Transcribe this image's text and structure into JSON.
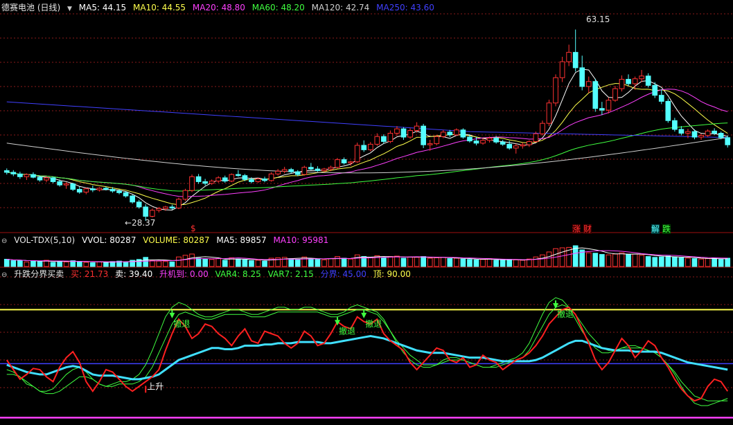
{
  "price_panel": {
    "title": "德赛电池 (日线)",
    "ma": [
      {
        "label": "MA5: 44.15",
        "color": "#ffffff"
      },
      {
        "label": "MA10: 44.55",
        "color": "#ffff4c"
      },
      {
        "label": "MA20: 48.80",
        "color": "#ff40ff"
      },
      {
        "label": "MA60: 48.20",
        "color": "#40ff40"
      },
      {
        "label": "MA120: 42.74",
        "color": "#d0d0d0"
      },
      {
        "label": "MA250: 43.60",
        "color": "#4040ff"
      }
    ],
    "high_label": "63.15",
    "low_label": "←28.37",
    "events": {
      "dollar": "$",
      "zhang": "涨",
      "cai": "财",
      "jie": "解",
      "die": "跌"
    }
  },
  "volume_panel": {
    "title": "VOL-TDX(5,10)",
    "items": [
      {
        "label": "VVOL: 80287",
        "color": "#ffffff"
      },
      {
        "label": "VOLUME: 80287",
        "color": "#ffff4c"
      },
      {
        "label": "MA5: 89857",
        "color": "#ffffff"
      },
      {
        "label": "MA10: 95981",
        "color": "#ff40ff"
      }
    ]
  },
  "indicator_panel": {
    "title": "升跌分界买卖",
    "items": [
      {
        "label": "买: 21.73",
        "color": "#ff3030"
      },
      {
        "label": "卖: 39.40",
        "color": "#ffffff"
      },
      {
        "label": "升机到: 0.00",
        "color": "#ff40ff"
      },
      {
        "label": "VAR4: 8.25",
        "color": "#40ff40"
      },
      {
        "label": "VAR7: 2.15",
        "color": "#40ff40"
      },
      {
        "label": "分界: 45.00",
        "color": "#4040ff"
      },
      {
        "label": "顶: 90.00",
        "color": "#ffff4c"
      }
    ],
    "signal_up": "上升",
    "signal_exit": "撤退"
  },
  "colors": {
    "up": "#ff3232",
    "down": "#54ffff",
    "grid": "#8b1a1a",
    "panel_sep": "#a01010"
  },
  "chart_data": {
    "type": "candlestick",
    "candles": [
      [
        37.5,
        37.9,
        36.8,
        37.2
      ],
      [
        37.2,
        37.6,
        36.5,
        36.9
      ],
      [
        36.9,
        37.3,
        36.0,
        36.4
      ],
      [
        36.4,
        37.0,
        35.8,
        36.8
      ],
      [
        36.8,
        37.2,
        36.1,
        36.3
      ],
      [
        36.3,
        36.6,
        35.5,
        35.8
      ],
      [
        35.8,
        36.5,
        35.4,
        36.2
      ],
      [
        36.2,
        36.4,
        35.2,
        35.5
      ],
      [
        35.5,
        35.9,
        34.6,
        34.9
      ],
      [
        34.9,
        35.4,
        34.2,
        35.1
      ],
      [
        35.1,
        35.3,
        33.8,
        34.1
      ],
      [
        34.1,
        34.6,
        33.3,
        33.6
      ],
      [
        33.6,
        34.4,
        33.2,
        34.2
      ],
      [
        34.2,
        34.8,
        33.6,
        34.0
      ],
      [
        34.0,
        34.5,
        33.7,
        34.3
      ],
      [
        34.3,
        34.6,
        33.9,
        34.1
      ],
      [
        34.1,
        34.5,
        33.5,
        33.8
      ],
      [
        33.8,
        34.1,
        33.2,
        33.5
      ],
      [
        33.5,
        33.8,
        32.6,
        32.9
      ],
      [
        32.9,
        33.1,
        31.5,
        31.8
      ],
      [
        31.8,
        32.2,
        30.6,
        30.9
      ],
      [
        30.9,
        31.4,
        28.37,
        29.2
      ],
      [
        29.2,
        30.6,
        29.0,
        30.3
      ],
      [
        30.3,
        30.9,
        29.9,
        30.6
      ],
      [
        30.6,
        31.1,
        30.2,
        30.9
      ],
      [
        30.9,
        31.3,
        30.4,
        30.7
      ],
      [
        30.7,
        32.6,
        30.5,
        32.3
      ],
      [
        32.3,
        34.2,
        32.0,
        33.9
      ],
      [
        33.9,
        36.8,
        33.6,
        36.4
      ],
      [
        36.4,
        36.9,
        35.1,
        35.5
      ],
      [
        35.5,
        36.0,
        34.8,
        35.2
      ],
      [
        35.2,
        35.9,
        34.9,
        35.6
      ],
      [
        35.6,
        36.5,
        35.3,
        36.2
      ],
      [
        36.2,
        36.6,
        35.3,
        35.6
      ],
      [
        35.6,
        37.0,
        35.4,
        36.8
      ],
      [
        36.8,
        37.6,
        36.4,
        36.6
      ],
      [
        36.6,
        36.9,
        35.6,
        35.9
      ],
      [
        35.9,
        36.3,
        35.2,
        35.5
      ],
      [
        35.5,
        36.2,
        35.3,
        36.0
      ],
      [
        36.0,
        36.4,
        35.4,
        35.7
      ],
      [
        35.7,
        37.2,
        35.5,
        36.9
      ],
      [
        36.9,
        37.8,
        36.6,
        37.4
      ],
      [
        37.4,
        38.2,
        37.0,
        37.7
      ],
      [
        37.7,
        38.0,
        37.0,
        37.3
      ],
      [
        37.3,
        37.6,
        36.5,
        36.8
      ],
      [
        36.8,
        38.4,
        36.6,
        38.1
      ],
      [
        38.1,
        38.9,
        37.6,
        37.8
      ],
      [
        37.8,
        38.3,
        37.3,
        37.5
      ],
      [
        37.5,
        38.0,
        37.2,
        37.8
      ],
      [
        37.8,
        38.4,
        37.4,
        38.1
      ],
      [
        38.1,
        39.8,
        37.9,
        39.5
      ],
      [
        39.5,
        39.9,
        38.6,
        38.9
      ],
      [
        38.9,
        39.3,
        38.4,
        39.1
      ],
      [
        39.1,
        42.6,
        38.9,
        42.1
      ],
      [
        42.1,
        43.0,
        40.9,
        41.3
      ],
      [
        41.3,
        42.7,
        41.0,
        42.3
      ],
      [
        42.3,
        44.3,
        42.0,
        43.7
      ],
      [
        43.7,
        44.1,
        42.4,
        42.8
      ],
      [
        42.8,
        44.8,
        42.5,
        44.3
      ],
      [
        44.3,
        45.6,
        43.8,
        45.1
      ],
      [
        45.1,
        45.4,
        43.1,
        43.6
      ],
      [
        43.6,
        45.2,
        43.3,
        44.8
      ],
      [
        44.8,
        46.3,
        44.4,
        45.6
      ],
      [
        45.6,
        46.0,
        41.6,
        42.2
      ],
      [
        42.2,
        43.1,
        41.1,
        42.4
      ],
      [
        42.4,
        44.0,
        42.1,
        43.7
      ],
      [
        43.7,
        44.9,
        43.4,
        44.5
      ],
      [
        44.5,
        44.9,
        43.6,
        44.0
      ],
      [
        44.0,
        45.2,
        43.8,
        44.9
      ],
      [
        44.9,
        45.2,
        43.3,
        43.6
      ],
      [
        43.6,
        44.1,
        42.6,
        42.9
      ],
      [
        42.9,
        43.6,
        42.1,
        42.5
      ],
      [
        42.5,
        43.3,
        42.2,
        43.0
      ],
      [
        43.0,
        43.7,
        42.6,
        43.4
      ],
      [
        43.4,
        43.8,
        42.4,
        42.7
      ],
      [
        42.7,
        43.1,
        42.0,
        42.3
      ],
      [
        42.3,
        42.9,
        41.3,
        41.6
      ],
      [
        41.6,
        42.4,
        40.6,
        42.0
      ],
      [
        42.0,
        42.6,
        41.5,
        42.2
      ],
      [
        42.2,
        43.0,
        41.8,
        42.8
      ],
      [
        42.8,
        44.6,
        42.6,
        44.2
      ],
      [
        44.2,
        46.6,
        43.9,
        46.1
      ],
      [
        46.1,
        50.4,
        45.6,
        49.8
      ],
      [
        49.8,
        55.0,
        49.2,
        54.4
      ],
      [
        54.4,
        58.2,
        53.6,
        57.3
      ],
      [
        57.3,
        60.4,
        56.5,
        59.0
      ],
      [
        59.0,
        63.15,
        55.5,
        56.2
      ],
      [
        56.2,
        58.4,
        52.1,
        52.8
      ],
      [
        52.8,
        54.6,
        51.6,
        53.7
      ],
      [
        53.7,
        54.2,
        48.2,
        48.8
      ],
      [
        48.8,
        50.0,
        47.6,
        48.5
      ],
      [
        48.5,
        50.8,
        47.9,
        50.3
      ],
      [
        50.3,
        52.9,
        50.0,
        52.4
      ],
      [
        52.4,
        54.8,
        51.9,
        54.1
      ],
      [
        54.1,
        55.0,
        52.9,
        53.3
      ],
      [
        53.3,
        54.6,
        52.2,
        54.2
      ],
      [
        54.2,
        55.8,
        53.6,
        54.7
      ],
      [
        54.7,
        55.2,
        52.6,
        53.0
      ],
      [
        53.0,
        53.6,
        50.7,
        51.2
      ],
      [
        51.2,
        52.3,
        49.6,
        50.1
      ],
      [
        50.1,
        50.6,
        46.2,
        46.6
      ],
      [
        46.6,
        47.1,
        44.6,
        45.0
      ],
      [
        45.0,
        45.6,
        43.9,
        44.3
      ],
      [
        44.3,
        45.1,
        43.4,
        44.6
      ],
      [
        44.6,
        45.0,
        43.2,
        43.6
      ],
      [
        43.6,
        44.2,
        43.1,
        43.9
      ],
      [
        43.9,
        45.0,
        43.6,
        44.7
      ],
      [
        44.7,
        45.2,
        44.0,
        44.3
      ],
      [
        44.3,
        44.6,
        43.2,
        43.5
      ],
      [
        43.5,
        43.9,
        41.7,
        42.2
      ]
    ],
    "volume": [
      35,
      28,
      30,
      22,
      26,
      24,
      30,
      20,
      26,
      22,
      28,
      24,
      20,
      18,
      22,
      20,
      24,
      26,
      22,
      30,
      34,
      44,
      28,
      26,
      24,
      22,
      46,
      54,
      60,
      40,
      36,
      34,
      38,
      30,
      42,
      36,
      32,
      28,
      30,
      26,
      40,
      42,
      44,
      38,
      34,
      46,
      38,
      34,
      32,
      38,
      48,
      40,
      36,
      56,
      48,
      44,
      52,
      42,
      48,
      50,
      40,
      46,
      44,
      48,
      40,
      42,
      44,
      38,
      40,
      36,
      34,
      32,
      34,
      38,
      30,
      30,
      34,
      32,
      30,
      36,
      46,
      56,
      70,
      86,
      90,
      92,
      100,
      80,
      66,
      64,
      58,
      56,
      60,
      66,
      58,
      60,
      54,
      48,
      44,
      46,
      50,
      46,
      42,
      40,
      38,
      36,
      38,
      40,
      34,
      40
    ],
    "ylim_price": [
      27,
      66
    ],
    "indicator": {
      "buy": [
        48,
        40,
        32,
        36,
        41,
        40,
        34,
        30,
        42,
        50,
        55,
        46,
        30,
        22,
        30,
        40,
        38,
        32,
        26,
        22,
        26,
        30,
        34,
        40,
        56,
        70,
        82,
        76,
        66,
        70,
        78,
        76,
        70,
        66,
        60,
        68,
        74,
        64,
        62,
        72,
        70,
        68,
        62,
        58,
        62,
        72,
        68,
        60,
        62,
        70,
        80,
        76,
        74,
        84,
        80,
        78,
        82,
        70,
        64,
        60,
        56,
        46,
        40,
        46,
        52,
        58,
        56,
        48,
        46,
        50,
        42,
        44,
        52,
        48,
        46,
        40,
        44,
        48,
        50,
        54,
        60,
        68,
        78,
        84,
        90,
        92,
        86,
        74,
        62,
        48,
        40,
        46,
        56,
        66,
        60,
        50,
        56,
        64,
        60,
        50,
        42,
        32,
        24,
        18,
        14,
        16,
        26,
        32,
        30,
        22
      ],
      "sell": [
        44,
        42,
        40,
        38,
        37,
        36,
        36,
        38,
        40,
        42,
        43,
        42,
        39,
        36,
        35,
        35,
        35,
        34,
        33,
        32,
        32,
        33,
        34,
        36,
        40,
        44,
        48,
        50,
        52,
        54,
        56,
        58,
        58,
        57,
        57,
        58,
        60,
        60,
        60,
        61,
        61,
        62,
        62,
        62,
        63,
        63,
        63,
        63,
        62,
        62,
        63,
        64,
        65,
        66,
        67,
        68,
        67,
        66,
        64,
        62,
        60,
        58,
        56,
        55,
        54,
        54,
        54,
        53,
        52,
        51,
        50,
        50,
        50,
        49,
        48,
        47,
        47,
        47,
        47,
        47,
        48,
        50,
        53,
        56,
        59,
        62,
        64,
        64,
        62,
        60,
        58,
        57,
        56,
        56,
        56,
        55,
        55,
        55,
        55,
        54,
        52,
        50,
        48,
        46,
        45,
        44,
        43,
        42,
        41,
        40
      ],
      "var4": [
        40,
        38,
        34,
        28,
        26,
        22,
        22,
        24,
        30,
        36,
        40,
        42,
        38,
        32,
        28,
        26,
        28,
        30,
        30,
        32,
        36,
        44,
        56,
        70,
        84,
        92,
        96,
        94,
        90,
        86,
        84,
        84,
        86,
        88,
        90,
        90,
        88,
        86,
        86,
        88,
        90,
        92,
        92,
        90,
        90,
        92,
        92,
        90,
        88,
        86,
        86,
        88,
        92,
        94,
        92,
        90,
        88,
        82,
        72,
        62,
        54,
        48,
        44,
        42,
        42,
        44,
        48,
        50,
        50,
        48,
        46,
        44,
        42,
        42,
        44,
        46,
        48,
        50,
        54,
        62,
        74,
        86,
        96,
        100,
        98,
        92,
        82,
        72,
        64,
        58,
        54,
        54,
        56,
        58,
        60,
        60,
        58,
        56,
        54,
        50,
        44,
        36,
        26,
        18,
        12,
        10,
        10,
        12,
        14,
        14
      ],
      "var7": [
        36,
        36,
        34,
        30,
        26,
        22,
        20,
        20,
        22,
        26,
        30,
        34,
        34,
        32,
        28,
        26,
        26,
        28,
        28,
        28,
        30,
        34,
        42,
        54,
        66,
        78,
        86,
        88,
        86,
        84,
        82,
        82,
        84,
        86,
        86,
        86,
        86,
        84,
        84,
        84,
        86,
        88,
        88,
        88,
        88,
        88,
        88,
        88,
        86,
        84,
        84,
        86,
        88,
        90,
        90,
        88,
        86,
        80,
        72,
        64,
        58,
        52,
        48,
        44,
        44,
        44,
        46,
        48,
        48,
        48,
        46,
        44,
        42,
        42,
        42,
        44,
        46,
        48,
        50,
        56,
        66,
        76,
        86,
        92,
        94,
        92,
        86,
        78,
        70,
        64,
        58,
        56,
        56,
        58,
        58,
        58,
        58,
        56,
        54,
        50,
        44,
        38,
        30,
        24,
        18,
        16,
        14,
        14,
        14,
        16
      ],
      "boundary": 45,
      "top": 90,
      "up_signals": [
        21
      ],
      "exit_signals": [
        25,
        50,
        54,
        83
      ],
      "ylim": [
        -5,
        115
      ]
    }
  }
}
